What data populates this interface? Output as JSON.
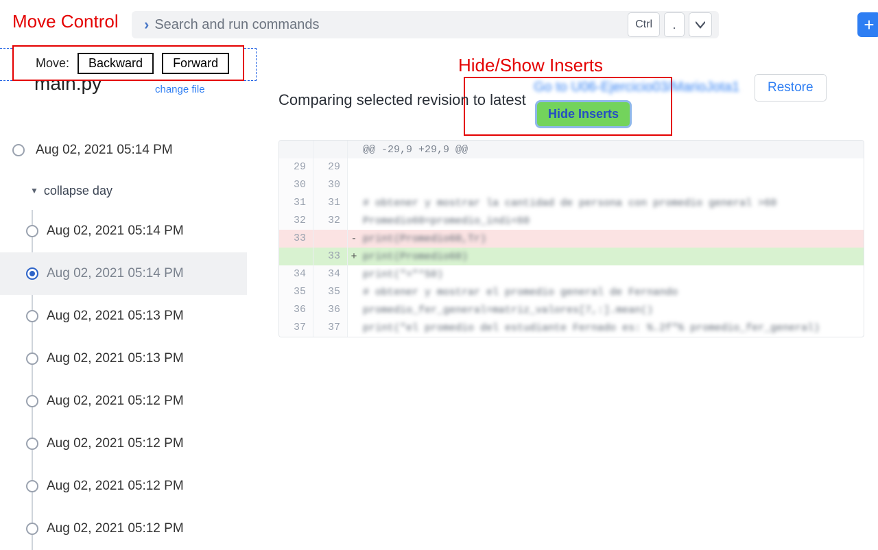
{
  "annotations": {
    "move_control": "Move Control",
    "hide_show_inserts": "Hide/Show Inserts"
  },
  "searchbar": {
    "placeholder": "Search and run commands",
    "shortcut_ctrl": "Ctrl",
    "shortcut_dot": "."
  },
  "move": {
    "label": "Move:",
    "backward": "Backward",
    "forward": "Forward"
  },
  "file": {
    "name": "main.py",
    "change": "change file"
  },
  "sidebar": {
    "top_revision": "Aug 02, 2021 05:14 PM",
    "collapse": "collapse day",
    "revisions": [
      "Aug 02, 2021 05:14 PM",
      "Aug 02, 2021 05:14 PM",
      "Aug 02, 2021 05:13 PM",
      "Aug 02, 2021 05:13 PM",
      "Aug 02, 2021 05:12 PM",
      "Aug 02, 2021 05:12 PM",
      "Aug 02, 2021 05:12 PM",
      "Aug 02, 2021 05:12 PM"
    ],
    "selected_index": 1
  },
  "main": {
    "compare_text": "Comparing selected revision to latest",
    "goto_link": "Go to U06-Ejercicio03/MarioJota1",
    "restore": "Restore",
    "hide_inserts": "Hide Inserts"
  },
  "diff": {
    "hunk": "@@ -29,9 +29,9 @@",
    "rows": [
      {
        "l": "29",
        "r": "29",
        "m": " ",
        "t": ""
      },
      {
        "l": "30",
        "r": "30",
        "m": " ",
        "t": ""
      },
      {
        "l": "31",
        "r": "31",
        "m": " ",
        "t": "# obtener y mostrar la cantidad de persona con promedio general >60"
      },
      {
        "l": "32",
        "r": "32",
        "m": " ",
        "t": "Promedio60=promedio_indi<60"
      },
      {
        "l": "33",
        "r": "",
        "m": "-",
        "t": "print(Promedio60,Tr)"
      },
      {
        "l": "",
        "r": "33",
        "m": "+",
        "t": "print(Promedio60)"
      },
      {
        "l": "34",
        "r": "34",
        "m": " ",
        "t": "print(\"=\"*50)"
      },
      {
        "l": "35",
        "r": "35",
        "m": " ",
        "t": "# obtener y mostrar el promedio general de Fernando"
      },
      {
        "l": "36",
        "r": "36",
        "m": " ",
        "t": "promedio_fer_general=matriz_valores[7,:].mean()"
      },
      {
        "l": "37",
        "r": "37",
        "m": " ",
        "t": "print(\"el promedio del estudiante Fernado es: %.2f\"% promedio_fer_general)"
      }
    ]
  }
}
